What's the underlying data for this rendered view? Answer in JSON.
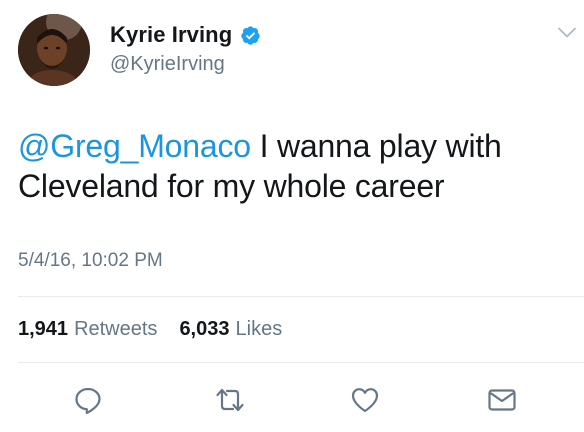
{
  "tweet": {
    "author": {
      "display_name": "Kyrie Irving",
      "handle": "@KyrieIrving",
      "verified": true,
      "avatar_icon": "profile-photo"
    },
    "text": {
      "mention": "@Greg_Monaco",
      "body": " I wanna play with Cleveland for my whole career"
    },
    "timestamp": "5/4/16, 10:02 PM",
    "stats": {
      "retweets_count": "1,941",
      "retweets_label": "Retweets",
      "likes_count": "6,033",
      "likes_label": "Likes"
    },
    "actions": [
      {
        "name": "reply",
        "icon": "reply-icon"
      },
      {
        "name": "retweet",
        "icon": "retweet-icon"
      },
      {
        "name": "like",
        "icon": "heart-icon"
      },
      {
        "name": "message",
        "icon": "envelope-icon"
      }
    ],
    "colors": {
      "link": "#1b95e0",
      "muted": "#657786",
      "verified_badge": "#1da1f2",
      "divider": "#e6ecf0"
    }
  }
}
